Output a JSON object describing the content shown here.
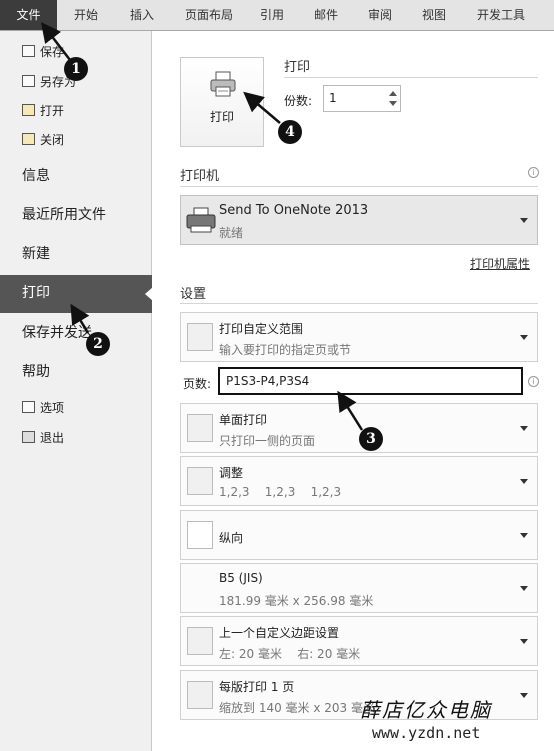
{
  "ribbon": {
    "tabs": [
      "文件",
      "开始",
      "插入",
      "页面布局",
      "引用",
      "邮件",
      "审阅",
      "视图",
      "开发工具"
    ]
  },
  "nav": {
    "small_items": [
      "保存",
      "另存为",
      "打开",
      "关闭"
    ],
    "big_items": [
      "信息",
      "最近所用文件",
      "新建",
      "打印",
      "保存并发送",
      "帮助"
    ],
    "bottom_items": [
      "选项",
      "退出"
    ]
  },
  "print": {
    "section_title": "打印",
    "button_label": "打印",
    "copies_label": "份数:",
    "copies_value": "1"
  },
  "printer": {
    "section_title": "打印机",
    "name": "Send To OneNote 2013",
    "status": "就绪",
    "properties_link": "打印机属性"
  },
  "settings": {
    "section_title": "设置",
    "range_title": "打印自定义范围",
    "range_desc": "输入要打印的指定页或节",
    "pages_label": "页数:",
    "pages_value": "P1S3-P4,P3S4",
    "sided_title": "单面打印",
    "sided_desc": "只打印一侧的页面",
    "collate_title": "调整",
    "collate_desc": "1,2,3    1,2,3    1,2,3",
    "orientation": "纵向",
    "paper_title": "B5 (JIS)",
    "paper_desc": "181.99 毫米 x 256.98 毫米",
    "margin_title": "上一个自定义边距设置",
    "margin_desc": "左: 20 毫米    右: 20 毫米",
    "pages_per_sheet_title": "每版打印 1 页",
    "pages_per_sheet_desc": "缩放到 140 毫米 x 203 毫米"
  },
  "callouts": [
    "1",
    "2",
    "3",
    "4"
  ],
  "watermark": {
    "text": "薛店亿众电脑",
    "url": "www.yzdn.net"
  }
}
